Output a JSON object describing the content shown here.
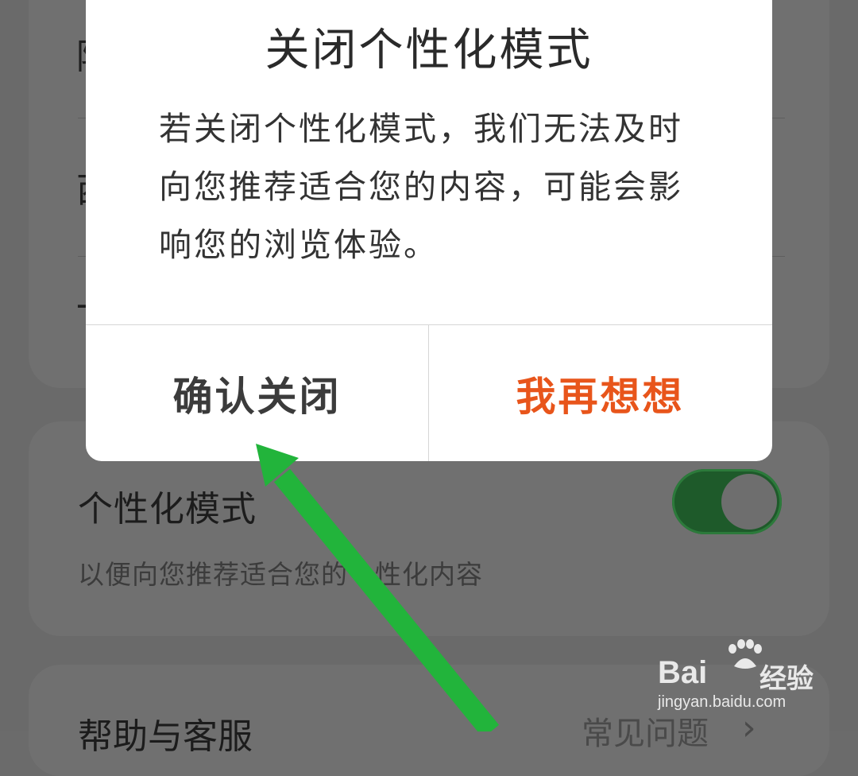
{
  "background": {
    "stub_1": "陌",
    "stub_2": "西",
    "stub_3": "一"
  },
  "setting": {
    "title": "个性化模式",
    "description": "以便向您推荐适合您的个性化内容",
    "toggle_on": true
  },
  "help": {
    "label": "帮助与客服",
    "faq": "常见问题",
    "chevron": "›"
  },
  "dialog": {
    "title": "关闭个性化模式",
    "message": "若关闭个性化模式，我们无法及时向您推荐适合您的内容，可能会影响您的浏览体验。",
    "confirm": "确认关闭",
    "rethink": "我再想想"
  },
  "watermark": {
    "brand": "Bai",
    "brand_cn": "经验",
    "url": "jingyan.baidu.com"
  },
  "colors": {
    "accent_orange": "#e8551b",
    "arrow_green": "#22b43b",
    "toggle_green": "#1e5a2a"
  }
}
